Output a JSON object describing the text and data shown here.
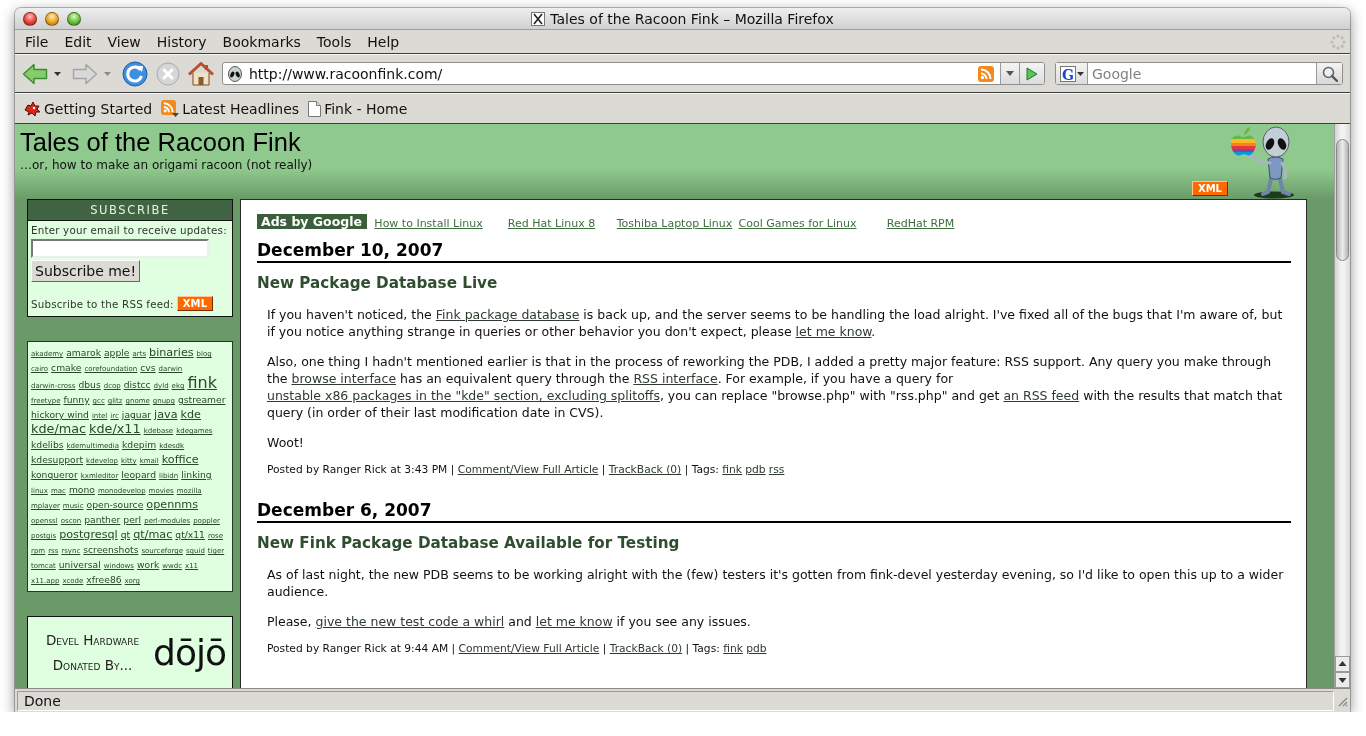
{
  "window": {
    "title": "Tales of the Racoon Fink – Mozilla Firefox"
  },
  "menu": [
    "File",
    "Edit",
    "View",
    "History",
    "Bookmarks",
    "Tools",
    "Help"
  ],
  "toolbar": {
    "nav_buttons": [
      {
        "kind": "back",
        "disabled": false
      },
      {
        "kind": "forward",
        "disabled": true
      },
      {
        "kind": "reload",
        "disabled": false
      },
      {
        "kind": "stop",
        "disabled": true
      },
      {
        "kind": "home",
        "disabled": false
      }
    ],
    "address": "http://www.racoonfink.com/",
    "search": {
      "engine_glyph": "G",
      "placeholder": "Google"
    }
  },
  "bookmarks": [
    {
      "kind": "start",
      "label": "Getting Started"
    },
    {
      "kind": "feed",
      "label": "Latest Headlines"
    },
    {
      "kind": "page",
      "label": "Fink - Home"
    }
  ],
  "page": {
    "blog_title": "Tales of the Racoon Fink",
    "tagline": "…or, how to make an origami racoon (not really)",
    "header_badge": "XML",
    "subscribe": {
      "title": "SUBSCRIBE",
      "email_label": "Enter your email to receive updates:",
      "button": "Subscribe me!",
      "rss_label": "Subscribe to the RSS feed:",
      "rss_badge": "XML"
    },
    "tags": [
      {
        "label": "akademy",
        "kind": "tiny"
      },
      {
        "label": "amarok",
        "kind": "small"
      },
      {
        "label": "apple",
        "kind": "small"
      },
      {
        "label": "arts",
        "kind": "tiny"
      },
      {
        "label": "binaries",
        "kind": "medium"
      },
      {
        "label": "blog",
        "kind": "tiny"
      },
      {
        "label": "cairo",
        "kind": "tiny"
      },
      {
        "label": "cmake",
        "kind": "small"
      },
      {
        "label": "corefoundation",
        "kind": "tiny"
      },
      {
        "label": "cvs",
        "kind": "small"
      },
      {
        "label": "darwin",
        "kind": "tiny"
      },
      {
        "label": "darwin-cross",
        "kind": "tiny"
      },
      {
        "label": "dbus",
        "kind": "small"
      },
      {
        "label": "dcop",
        "kind": "tiny"
      },
      {
        "label": "distcc",
        "kind": "small"
      },
      {
        "label": "dyld",
        "kind": "tiny"
      },
      {
        "label": "ekg",
        "kind": "tiny"
      },
      {
        "label": "fink",
        "kind": "huge"
      },
      {
        "label": "freetype",
        "kind": "tiny"
      },
      {
        "label": "funny",
        "kind": "small"
      },
      {
        "label": "gcc",
        "kind": "tiny"
      },
      {
        "label": "glitz",
        "kind": "tiny"
      },
      {
        "label": "gnome",
        "kind": "tiny"
      },
      {
        "label": "gnupg",
        "kind": "tiny"
      },
      {
        "label": "gstreamer",
        "kind": "small"
      },
      {
        "label": "hickory wind",
        "kind": "small"
      },
      {
        "label": "intel",
        "kind": "tiny"
      },
      {
        "label": "irc",
        "kind": "tiny"
      },
      {
        "label": "jaguar",
        "kind": "small"
      },
      {
        "label": "java",
        "kind": "medium"
      },
      {
        "label": "kde",
        "kind": "medium"
      },
      {
        "label": "kde/mac",
        "kind": "large"
      },
      {
        "label": "kde/x11",
        "kind": "large"
      },
      {
        "label": "kdebase",
        "kind": "tiny"
      },
      {
        "label": "kdegames",
        "kind": "tiny"
      },
      {
        "label": "kdelibs",
        "kind": "small"
      },
      {
        "label": "kdemultimedia",
        "kind": "tiny"
      },
      {
        "label": "kdepim",
        "kind": "small"
      },
      {
        "label": "kdesdk",
        "kind": "tiny"
      },
      {
        "label": "kdesupport",
        "kind": "small"
      },
      {
        "label": "kdevelop",
        "kind": "tiny"
      },
      {
        "label": "kitty",
        "kind": "tiny"
      },
      {
        "label": "kmail",
        "kind": "tiny"
      },
      {
        "label": "koffice",
        "kind": "medium"
      },
      {
        "label": "konqueror",
        "kind": "small"
      },
      {
        "label": "kxmleditor",
        "kind": "tiny"
      },
      {
        "label": "leopard",
        "kind": "small"
      },
      {
        "label": "libidn",
        "kind": "tiny"
      },
      {
        "label": "linking",
        "kind": "small"
      },
      {
        "label": "linux",
        "kind": "tiny"
      },
      {
        "label": "mac",
        "kind": "tiny"
      },
      {
        "label": "mono",
        "kind": "small"
      },
      {
        "label": "monodevelop",
        "kind": "tiny"
      },
      {
        "label": "movies",
        "kind": "tiny"
      },
      {
        "label": "mozilla",
        "kind": "tiny"
      },
      {
        "label": "mplayer",
        "kind": "tiny"
      },
      {
        "label": "music",
        "kind": "tiny"
      },
      {
        "label": "open-source",
        "kind": "small"
      },
      {
        "label": "opennms",
        "kind": "medium"
      },
      {
        "label": "openssl",
        "kind": "tiny"
      },
      {
        "label": "oscon",
        "kind": "tiny"
      },
      {
        "label": "panther",
        "kind": "small"
      },
      {
        "label": "perl",
        "kind": "small"
      },
      {
        "label": "perl-modules",
        "kind": "tiny"
      },
      {
        "label": "poppler",
        "kind": "tiny"
      },
      {
        "label": "postgis",
        "kind": "tiny"
      },
      {
        "label": "postgresql",
        "kind": "medium"
      },
      {
        "label": "qt",
        "kind": "small"
      },
      {
        "label": "qt/mac",
        "kind": "medium"
      },
      {
        "label": "qt/x11",
        "kind": "small"
      },
      {
        "label": "rose",
        "kind": "tiny"
      },
      {
        "label": "rpm",
        "kind": "tiny"
      },
      {
        "label": "rss",
        "kind": "tiny"
      },
      {
        "label": "rsync",
        "kind": "tiny"
      },
      {
        "label": "screenshots",
        "kind": "small"
      },
      {
        "label": "sourceforge",
        "kind": "tiny"
      },
      {
        "label": "squid",
        "kind": "tiny"
      },
      {
        "label": "tiger",
        "kind": "tiny"
      },
      {
        "label": "tomcat",
        "kind": "tiny"
      },
      {
        "label": "universal",
        "kind": "small"
      },
      {
        "label": "windows",
        "kind": "tiny"
      },
      {
        "label": "work",
        "kind": "small"
      },
      {
        "label": "wwdc",
        "kind": "tiny"
      },
      {
        "label": "x11",
        "kind": "tiny"
      },
      {
        "label": "x11.app",
        "kind": "tiny"
      },
      {
        "label": "xcode",
        "kind": "tiny"
      },
      {
        "label": "xfree86",
        "kind": "small"
      },
      {
        "label": "xorg",
        "kind": "tiny"
      }
    ],
    "sponsor": {
      "tagline": "Devel Hardware Donated By...",
      "logo": "dōjō"
    },
    "ads": {
      "label": "Ads by Google",
      "links": [
        "How to Install Linux",
        "Red Hat Linux 8",
        "Toshiba Laptop Linux",
        "Cool Games for Linux",
        "RedHat RPM"
      ]
    },
    "posts": [
      {
        "date": "December 10, 2007",
        "title": "New Package Database Live",
        "paragraphs": [
          [
            {
              "kind": "text",
              "text": "If you haven't noticed, the "
            },
            {
              "kind": "link",
              "text": "Fink package database"
            },
            {
              "kind": "text",
              "text": " is back up, and the server seems to be handling the load alright. I've fixed all of the bugs that I'm aware of, but if you notice anything strange in queries or other behavior you don't expect, please "
            },
            {
              "kind": "link",
              "text": "let me know"
            },
            {
              "kind": "text",
              "text": "."
            }
          ],
          [
            {
              "kind": "text",
              "text": "Also, one thing I hadn't mentioned earlier is that in the process of reworking the PDB, I added a pretty major feature: RSS support. Any query you make through the "
            },
            {
              "kind": "link",
              "text": "browse interface"
            },
            {
              "kind": "text",
              "text": " has an equivalent query through the "
            },
            {
              "kind": "link",
              "text": "RSS interface"
            },
            {
              "kind": "text",
              "text": ". For example, if you have a query for "
            },
            {
              "kind": "link",
              "text": "unstable x86 packages in the \"kde\" section, excluding splitoffs"
            },
            {
              "kind": "text",
              "text": ", you can replace \"browse.php\" with \"rss.php\" and get "
            },
            {
              "kind": "link",
              "text": "an RSS feed"
            },
            {
              "kind": "text",
              "text": " with the results that match that query (in order of their last modification date in CVS)."
            }
          ],
          [
            {
              "kind": "text",
              "text": "Woot!"
            }
          ]
        ],
        "footer": [
          {
            "kind": "text",
            "text": "Posted by Ranger Rick at 3:43 PM | "
          },
          {
            "kind": "link",
            "text": "Comment/View Full Article"
          },
          {
            "kind": "text",
            "text": " | "
          },
          {
            "kind": "link",
            "text": "TrackBack (0)"
          },
          {
            "kind": "text",
            "text": " | Tags: "
          },
          {
            "kind": "tag",
            "text": "fink"
          },
          {
            "kind": "tag",
            "text": "pdb"
          },
          {
            "kind": "tag",
            "text": "rss"
          }
        ]
      },
      {
        "date": "December 6, 2007",
        "title": "New Fink Package Database Available for Testing",
        "paragraphs": [
          [
            {
              "kind": "text",
              "text": "As of last night, the new PDB seems to be working alright with the (few) testers it's gotten from fink-devel yesterday evening, so I'd like to open this up to a wider audience."
            }
          ],
          [
            {
              "kind": "text",
              "text": "Please, "
            },
            {
              "kind": "link",
              "text": "give the new test code a whirl"
            },
            {
              "kind": "text",
              "text": " and "
            },
            {
              "kind": "link",
              "text": "let me know"
            },
            {
              "kind": "text",
              "text": " if you see any issues."
            }
          ]
        ],
        "footer": [
          {
            "kind": "text",
            "text": "Posted by Ranger Rick at 9:44 AM | "
          },
          {
            "kind": "link",
            "text": "Comment/View Full Article"
          },
          {
            "kind": "text",
            "text": " | "
          },
          {
            "kind": "link",
            "text": "TrackBack (0)"
          },
          {
            "kind": "text",
            "text": " | Tags: "
          },
          {
            "kind": "tag",
            "text": "fink"
          },
          {
            "kind": "tag",
            "text": "pdb"
          }
        ]
      }
    ]
  },
  "status_bar": {
    "text": "Done"
  }
}
